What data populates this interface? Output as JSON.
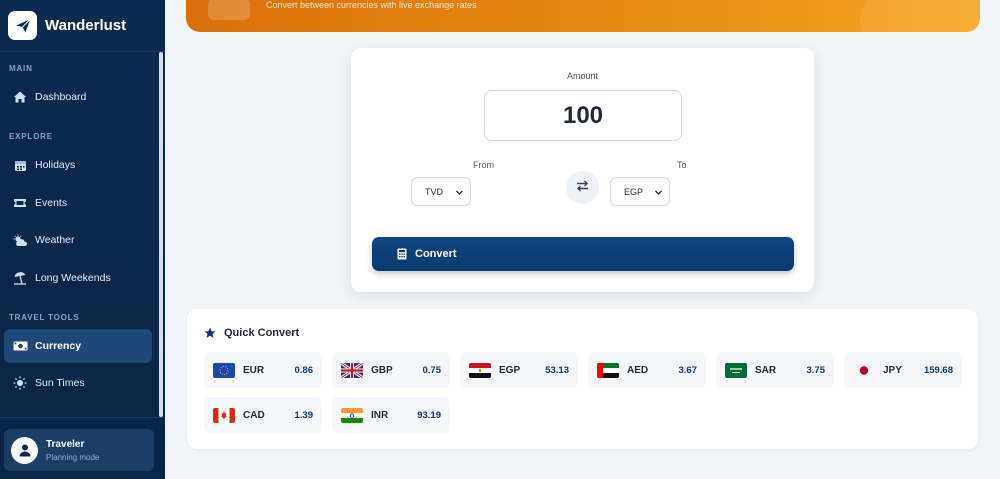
{
  "app": {
    "name": "Wanderlust"
  },
  "sidebar": {
    "sections": [
      {
        "label": "MAIN"
      },
      {
        "label": "EXPLORE"
      },
      {
        "label": "TRAVEL TOOLS"
      }
    ],
    "items": [
      {
        "label": "Dashboard",
        "icon": "home-icon"
      },
      {
        "label": "Holidays",
        "icon": "calendar-icon"
      },
      {
        "label": "Events",
        "icon": "ticket-icon"
      },
      {
        "label": "Weather",
        "icon": "cloud-sun-icon"
      },
      {
        "label": "Long Weekends",
        "icon": "umbrella-beach-icon"
      },
      {
        "label": "Currency",
        "icon": "money-icon",
        "active": true
      },
      {
        "label": "Sun Times",
        "icon": "sun-icon"
      }
    ],
    "user": {
      "name": "Traveler",
      "subtitle": "Planning mode"
    }
  },
  "banner": {
    "subtitle": "Convert between currencies with live exchange rates"
  },
  "converter": {
    "amount_label": "Amount",
    "amount_value": "100",
    "from_label": "From",
    "to_label": "To",
    "from_value": "TVD",
    "to_value": "EGP",
    "convert_label": "Convert"
  },
  "quick_convert": {
    "title": "Quick Convert",
    "rates": [
      {
        "code": "EUR",
        "value": "0.86",
        "flag": "eu"
      },
      {
        "code": "GBP",
        "value": "0.75",
        "flag": "gb"
      },
      {
        "code": "EGP",
        "value": "53.13",
        "flag": "eg"
      },
      {
        "code": "AED",
        "value": "3.67",
        "flag": "ae"
      },
      {
        "code": "SAR",
        "value": "3.75",
        "flag": "sa"
      },
      {
        "code": "JPY",
        "value": "159.68",
        "flag": "jp"
      },
      {
        "code": "CAD",
        "value": "1.39",
        "flag": "ca"
      },
      {
        "code": "INR",
        "value": "93.19",
        "flag": "in"
      }
    ]
  },
  "colors": {
    "sidebar_bg": "#0b2a4f",
    "accent_orange": "#e98d13",
    "primary_blue": "#0e4582"
  }
}
